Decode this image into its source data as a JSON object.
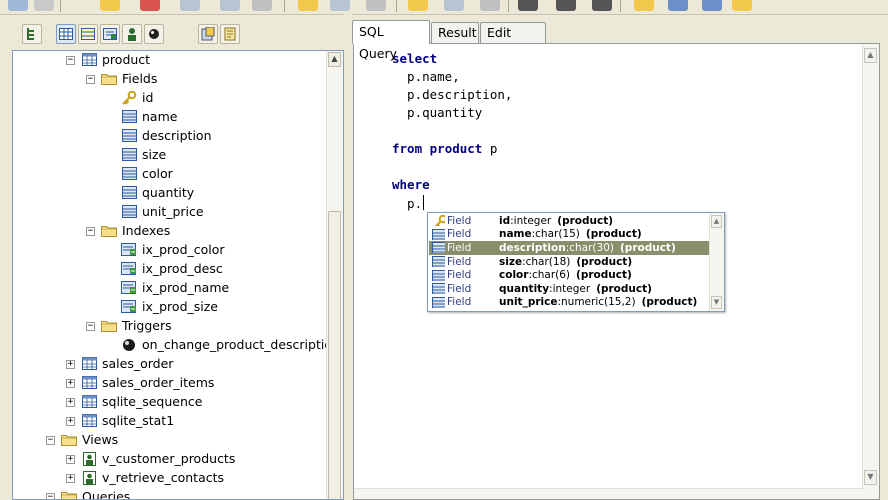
{
  "left_toolbar": {
    "buttons": [
      "tree-view-icon",
      "table-icon",
      "view-icon",
      "index-icon",
      "user-icon",
      "trigger-icon",
      "sql-icon",
      "script-icon"
    ]
  },
  "tree": {
    "items": [
      {
        "label": "product",
        "icon": "table-icon",
        "expander": "−"
      },
      {
        "label": "Fields",
        "icon": "folder-icon",
        "expander": "−"
      },
      {
        "label": "id",
        "icon": "key-icon",
        "expander": ""
      },
      {
        "label": "name",
        "icon": "field-icon",
        "expander": ""
      },
      {
        "label": "description",
        "icon": "field-icon",
        "expander": ""
      },
      {
        "label": "size",
        "icon": "field-icon",
        "expander": ""
      },
      {
        "label": "color",
        "icon": "field-icon",
        "expander": ""
      },
      {
        "label": "quantity",
        "icon": "field-icon",
        "expander": ""
      },
      {
        "label": "unit_price",
        "icon": "field-icon",
        "expander": ""
      },
      {
        "label": "Indexes",
        "icon": "folder-icon",
        "expander": "−"
      },
      {
        "label": "ix_prod_color",
        "icon": "index-icon",
        "expander": ""
      },
      {
        "label": "ix_prod_desc",
        "icon": "index-icon",
        "expander": ""
      },
      {
        "label": "ix_prod_name",
        "icon": "index-icon",
        "expander": ""
      },
      {
        "label": "ix_prod_size",
        "icon": "index-icon",
        "expander": ""
      },
      {
        "label": "Triggers",
        "icon": "folder-icon",
        "expander": "−"
      },
      {
        "label": "on_change_product_description",
        "icon": "trigger-icon",
        "expander": ""
      },
      {
        "label": "sales_order",
        "icon": "table-icon",
        "expander": "+"
      },
      {
        "label": "sales_order_items",
        "icon": "table-icon",
        "expander": "+"
      },
      {
        "label": "sqlite_sequence",
        "icon": "table-icon",
        "expander": "+"
      },
      {
        "label": "sqlite_stat1",
        "icon": "table-icon",
        "expander": "+"
      },
      {
        "label": "Views",
        "icon": "folder-icon",
        "expander": "−"
      },
      {
        "label": "v_customer_products",
        "icon": "view-icon",
        "expander": "+"
      },
      {
        "label": "v_retrieve_contacts",
        "icon": "view-icon",
        "expander": "+"
      },
      {
        "label": "Queries",
        "icon": "folder-icon",
        "expander": "−"
      }
    ]
  },
  "tabs": [
    {
      "label": "SQL Query",
      "active": true
    },
    {
      "label": "Result",
      "active": false
    },
    {
      "label": "Edit Data",
      "active": false
    }
  ],
  "editor": {
    "lines": [
      {
        "kind": "kw",
        "text": "select"
      },
      {
        "kind": "plain",
        "text": "  p.name,"
      },
      {
        "kind": "plain",
        "text": "  p.description,"
      },
      {
        "kind": "plain",
        "text": "  p.quantity"
      },
      {
        "kind": "plain",
        "text": ""
      },
      {
        "kind": "from",
        "kw": "from",
        "table": "product",
        "alias": "p"
      },
      {
        "kind": "plain",
        "text": ""
      },
      {
        "kind": "kw",
        "text": "where"
      },
      {
        "kind": "caret",
        "text": "  p."
      }
    ]
  },
  "completion": {
    "items": [
      {
        "kind": "Field",
        "name": "id",
        "type": ":integer",
        "table": "(product)",
        "icon": "key-icon",
        "selected": false
      },
      {
        "kind": "Field",
        "name": "name",
        "type": ":char(15)",
        "table": "(product)",
        "icon": "field-icon",
        "selected": false
      },
      {
        "kind": "Field",
        "name": "description",
        "type": ":char(30)",
        "table": "(product)",
        "icon": "field-icon",
        "selected": true
      },
      {
        "kind": "Field",
        "name": "size",
        "type": ":char(18)",
        "table": "(product)",
        "icon": "field-icon",
        "selected": false
      },
      {
        "kind": "Field",
        "name": "color",
        "type": ":char(6)",
        "table": "(product)",
        "icon": "field-icon",
        "selected": false
      },
      {
        "kind": "Field",
        "name": "quantity",
        "type": ":integer",
        "table": "(product)",
        "icon": "field-icon",
        "selected": false
      },
      {
        "kind": "Field",
        "name": "unit_price",
        "type": ":numeric(15,2)",
        "table": "(product)",
        "icon": "field-icon",
        "selected": false
      }
    ]
  },
  "colors": {
    "keyword": "#000080",
    "selection": "#8b8e6b",
    "chrome": "#ece9d8",
    "border": "#7f9db9"
  }
}
